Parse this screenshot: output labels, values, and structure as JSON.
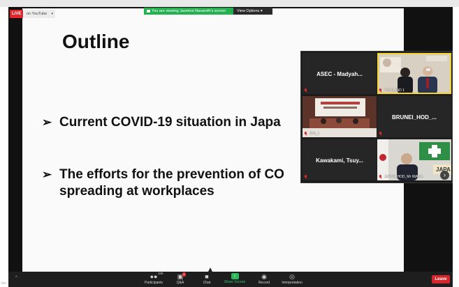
{
  "live_badge": "LIVE",
  "youtube": {
    "label": "on YouTube",
    "caret": "▾"
  },
  "banner": {
    "message": "You are viewing Jasmine Nazareth's screen",
    "view_options": "View Options ▾"
  },
  "slide": {
    "title": "Outline",
    "bullets": [
      {
        "arrow": "➢",
        "line1": "Current COVID-19 situation in Japa"
      },
      {
        "arrow": "➢",
        "line1": "The efforts for the prevention of CO",
        "line2": "spreading at workplaces"
      }
    ]
  },
  "gallery": {
    "tiles": [
      {
        "name": "ASEC - Madyah..."
      },
      {
        "caption": "THAILAND 1"
      },
      {
        "caption": "IDN_1"
      },
      {
        "name": "BRUNEI_HOD_..."
      },
      {
        "name": "Kawakami, Tsuy..."
      },
      {
        "caption": "JAPAN_HOD_Mr IWASA",
        "overlay": "JAPA"
      }
    ],
    "next": "›"
  },
  "toolbar": {
    "left_cut": "leo",
    "caret": "^",
    "participants": {
      "label": "Participants",
      "count": "106",
      "icon": "participants-icon"
    },
    "qa": {
      "label": "Q&A",
      "badge": "1",
      "icon": "qa-icon"
    },
    "chat": {
      "label": "Chat",
      "icon": "chat-icon"
    },
    "share": {
      "label": "Share Screen",
      "icon": "share-screen-icon"
    },
    "record": {
      "label": "Record",
      "icon": "record-icon"
    },
    "interpretation": {
      "label": "Interpretation",
      "icon": "globe-icon"
    },
    "leave": "Leave"
  },
  "colors": {
    "accent_green": "#23b04e",
    "leave_red": "#d5262b",
    "active_speaker": "#f2d230"
  }
}
